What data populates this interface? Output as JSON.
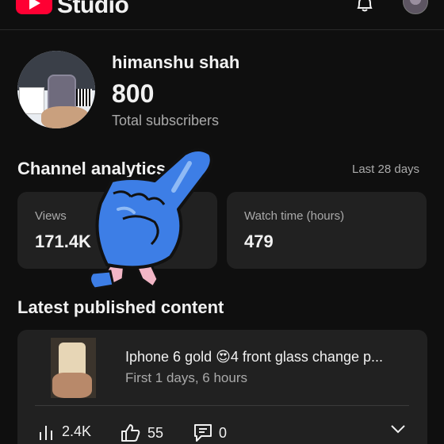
{
  "header": {
    "app_name": "Studio",
    "icons": [
      "youtube-logo-icon",
      "bell-icon",
      "account-avatar"
    ]
  },
  "profile": {
    "channel_name": "himanshu shah",
    "subscriber_count": "800",
    "subscriber_label": "Total subscribers"
  },
  "analytics": {
    "title": "Channel analytics",
    "period": "Last 28 days",
    "cards": [
      {
        "label": "Views",
        "value": "171.4K"
      },
      {
        "label": "Watch time (hours)",
        "value": "479"
      }
    ]
  },
  "latest": {
    "title": "Latest published content",
    "video": {
      "title": "Iphone 6 gold 😍4 front glass change  p...",
      "subtitle": "First 1 days, 6 hours",
      "stats": {
        "views": "2.4K",
        "likes": "55",
        "comments": "0"
      }
    }
  },
  "colors": {
    "background": "#0f0f0f",
    "card": "#212121",
    "accent_red": "#ff0033",
    "secondary_text": "#aaaaaa",
    "trend_green": "#2ba640",
    "sticker_blue": "#3d7ee6"
  }
}
